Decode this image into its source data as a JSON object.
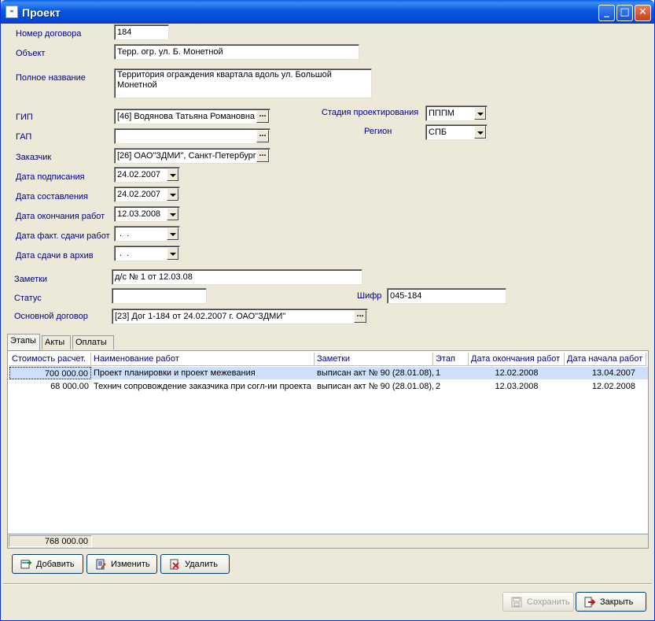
{
  "window": {
    "title": "Проект"
  },
  "fields": {
    "contract_number": {
      "label": "Номер договора",
      "value": "184"
    },
    "object": {
      "label": "Объект",
      "value": "Терр. огр. ул. Б. Монетной"
    },
    "full_name": {
      "label": "Полное название",
      "value": "Территория ограждения квартала вдоль ул. Большой Монетной"
    },
    "gip": {
      "label": "ГИП",
      "value": "[46]  Водянова Татьяна Романовна"
    },
    "gap": {
      "label": "ГАП",
      "value": ""
    },
    "customer": {
      "label": "Заказчик",
      "value": "[26]  ОАО\"ЗДМИ\", Санкт-Петербург"
    },
    "sign_date": {
      "label": "Дата подписания",
      "value": "24.02.2007"
    },
    "compile_date": {
      "label": "Дата составления",
      "value": "24.02.2007"
    },
    "end_date": {
      "label": "Дата окончания работ",
      "value": "12.03.2008"
    },
    "actual_date": {
      "label": "Дата факт. сдачи работ",
      "value": " .  ."
    },
    "archive_date": {
      "label": "Дата сдачи в архив",
      "value": " .  ."
    },
    "notes": {
      "label": "Заметки",
      "value": "д/с № 1 от 12.03.08"
    },
    "status": {
      "label": "Статус",
      "value": ""
    },
    "code": {
      "label": "Шифр",
      "value": "045-184"
    },
    "main_contract": {
      "label": "Основной договор",
      "value": "[23]  Дог 1-184 от 24.02.2007 г.  ОАО\"ЗДМИ\""
    },
    "stage": {
      "label": "Стадия проектирования",
      "value": "ПППМ"
    },
    "region": {
      "label": "Регион",
      "value": "СПБ"
    }
  },
  "tabs": [
    "Этапы",
    "Акты",
    "Оплаты"
  ],
  "grid": {
    "columns": [
      "Стоимость расчет.",
      "Наименование работ",
      "Заметки",
      "Этап",
      "Дата окончания работ",
      "Дата начала работ"
    ],
    "rows": [
      [
        "700 000.00",
        "Проект планировки и проект межевания",
        "выписан акт № 90 (28.01.08),",
        "1",
        "12.02.2008",
        "13.04.2007"
      ],
      [
        "68 000.00",
        "Технич сопровождение заказчика при согл-ии проекта",
        "выписан акт № 90 (28.01.08),",
        "2",
        "12.03.2008",
        "12.02.2008"
      ]
    ],
    "total": "768 000.00"
  },
  "buttons": {
    "add": "Добавить",
    "edit": "Изменить",
    "delete": "Удалить",
    "save": "Сохранить",
    "close": "Закрыть"
  },
  "icons": [
    "minimize-icon",
    "maximize-icon",
    "close-icon",
    "add-icon",
    "edit-icon",
    "delete-icon",
    "save-icon",
    "exit-icon"
  ],
  "colors": {
    "title_bar": "#0a57e0",
    "label_text": "#00008b",
    "selected_row": "#cfe0ff"
  }
}
